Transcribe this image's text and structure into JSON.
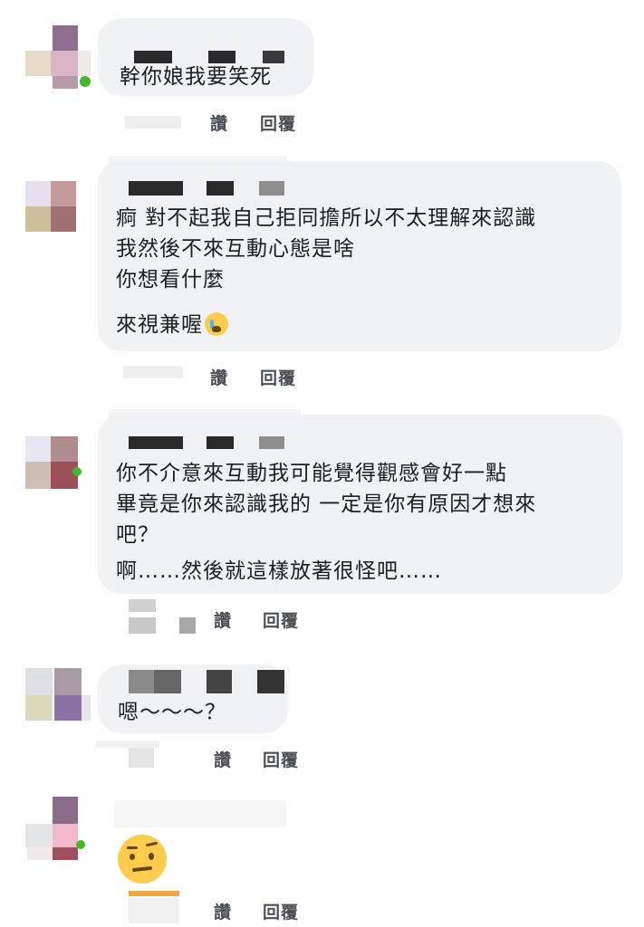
{
  "comments": [
    {
      "lines": [
        "幹你娘我要笑死"
      ],
      "actions": {
        "like": "讚",
        "reply": "回覆"
      }
    },
    {
      "lines": [
        "痾 對不起我自己拒同擔所以不太理解來認識",
        "我然後不來互動心態是啥",
        "你想看什麼",
        "來視兼喔"
      ],
      "emoji": "loudly-crying-face",
      "actions": {
        "like": "讚",
        "reply": "回覆"
      }
    },
    {
      "lines": [
        "你不介意來互動我可能覺得觀感會好一點",
        "畢竟是你來認識我的 一定是你有原因才想來",
        "吧？",
        "啊……然後就這樣放著很怪吧……"
      ],
      "actions": {
        "like": "讚",
        "reply": "回覆"
      }
    },
    {
      "lines": [
        "嗯～～～？"
      ],
      "actions": {
        "like": "讚",
        "reply": "回覆"
      }
    },
    {
      "emoji": "face-with-raised-eyebrow",
      "actions": {
        "like": "讚",
        "reply": "回覆"
      }
    }
  ],
  "colors": {
    "bubble": "#f0f2f5",
    "text": "#1c1e21",
    "action": "#4b4f56",
    "online": "#42b72a"
  }
}
